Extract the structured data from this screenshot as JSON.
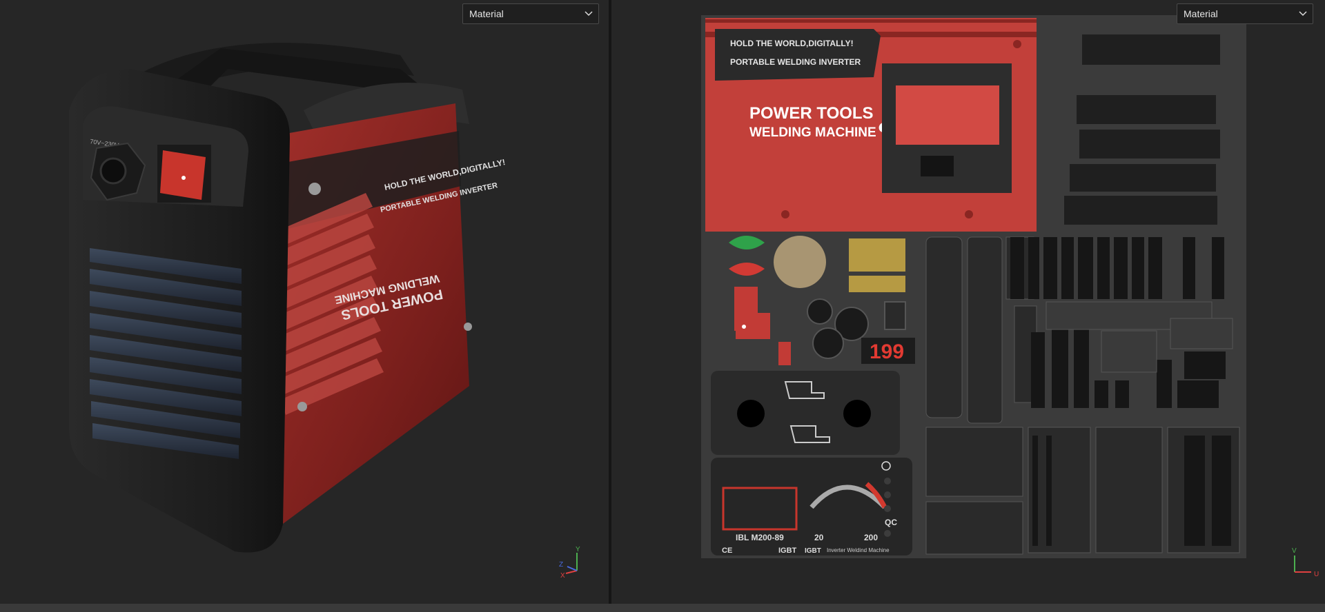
{
  "viewport3d": {
    "material_select": "Material"
  },
  "viewport2d": {
    "material_select": "Material"
  },
  "product": {
    "slogan": "HOLD THE WORLD,DIGITALLY!",
    "product_line": "PORTABLE WELDING INVERTER",
    "brand_line1": "POWER TOOLS",
    "brand_ampersand": "&",
    "brand_line2": "WELDING MACHINE",
    "voltage_label": "70V~230V"
  },
  "uv": {
    "display_value": "199",
    "model_code": "IBL M200-89",
    "dial_min": "20",
    "dial_max": "200",
    "qc_label": "QC",
    "cert_marks": "CE",
    "igbt1": "IGBT",
    "igbt2": "IGBT",
    "machine_caption": "Inverter Weldind Machine"
  },
  "gizmo3d": {
    "y": "Y",
    "z": "Z",
    "x": "X"
  },
  "gizmo2d": {
    "v": "V",
    "u": "U"
  },
  "colors": {
    "accent_red": "#c2403a",
    "dark_body": "#1e1e1e",
    "background": "#262626"
  }
}
